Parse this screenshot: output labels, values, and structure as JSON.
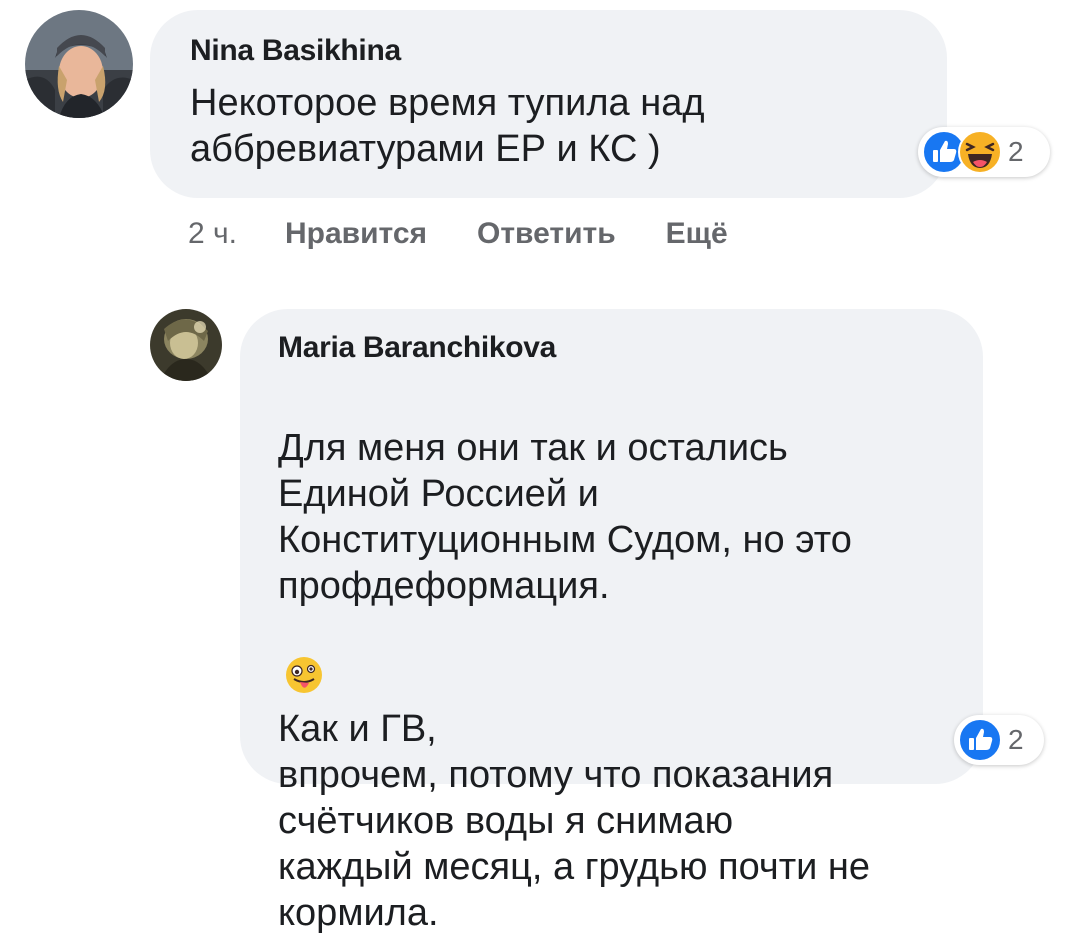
{
  "comments": [
    {
      "author": "Nina Basikhina",
      "text": "Некоторое время тупила над\nаббревиатурами ЕР и КС )",
      "reactions": {
        "icons": [
          "like-icon",
          "laugh-icon"
        ],
        "count": "2"
      },
      "meta": {
        "time": "2 ч.",
        "like": "Нравится",
        "reply": "Ответить",
        "more": "Ещё"
      }
    },
    {
      "author": "Maria Baranchikova",
      "text_part1": "Для меня они так и остались\nЕдиной Россией и\nКонституционным Судом, но это\nпрофдеформация.",
      "text_emoji": "zany-face-icon",
      "text_part2": "Как и ГВ,\nвпрочем, потому что показания\nсчётчиков воды я снимаю\nкаждый месяц, а грудью почти не\nкормила.",
      "reactions": {
        "icons": [
          "like-icon"
        ],
        "count": "2"
      }
    }
  ],
  "colors": {
    "bubble": "#f0f2f5",
    "text": "#1c1e21",
    "meta": "#65676b",
    "like_blue": "#1877f2",
    "haha_yellow": "#f7b125"
  }
}
